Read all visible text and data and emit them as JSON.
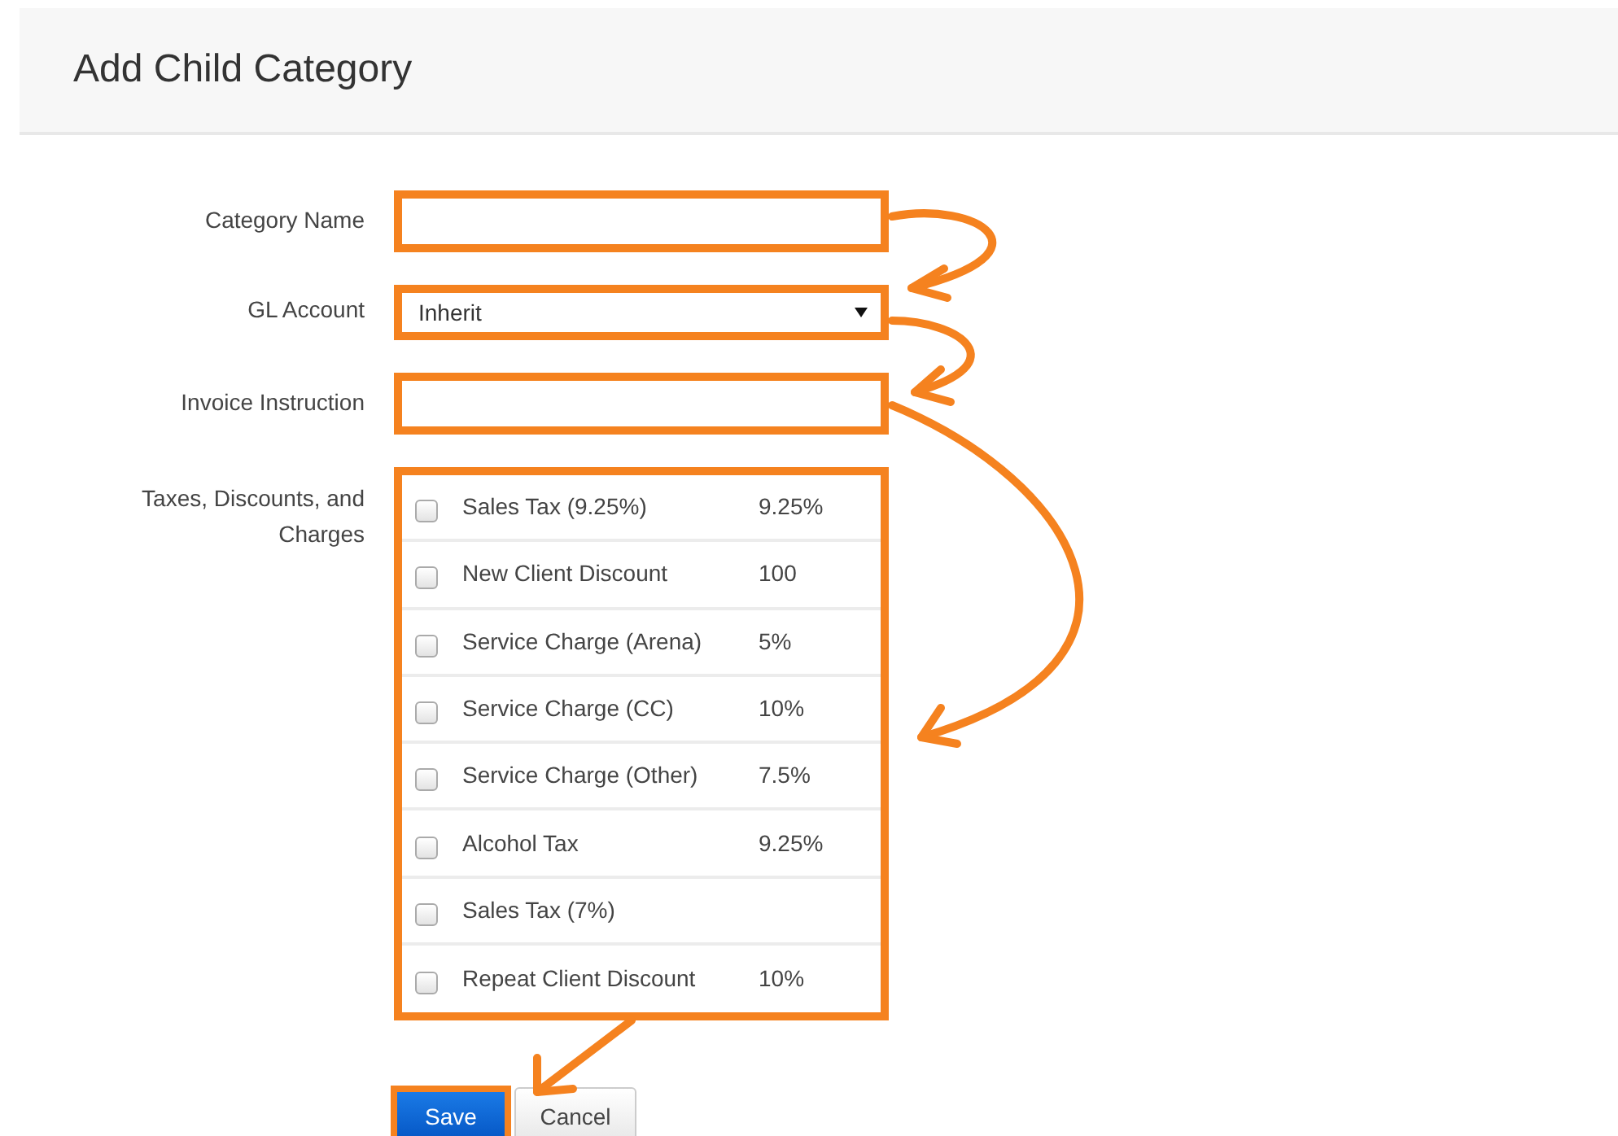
{
  "header": {
    "title": "Add Child Category"
  },
  "fields": [
    {
      "kind": "text",
      "label": "Category Name"
    },
    {
      "kind": "select",
      "label": "GL Account",
      "value": "Inherit"
    },
    {
      "kind": "text",
      "label": "Invoice Instruction"
    }
  ],
  "charges": {
    "label": "Taxes, Discounts, and Charges",
    "items": [
      {
        "name": "Sales Tax (9.25%)",
        "amount": "9.25%",
        "checked": false
      },
      {
        "name": "New Client Discount",
        "amount": "100",
        "checked": false
      },
      {
        "name": "Service Charge (Arena)",
        "amount": "5%",
        "checked": false
      },
      {
        "name": "Service Charge (CC)",
        "amount": "10%",
        "checked": false
      },
      {
        "name": "Service Charge (Other)",
        "amount": "7.5%",
        "checked": false
      },
      {
        "name": "Alcohol Tax",
        "amount": "9.25%",
        "checked": false
      },
      {
        "name": "Sales Tax (7%)",
        "checked": false
      },
      {
        "name": "Repeat Client Discount",
        "amount": "10%",
        "checked": false
      }
    ]
  },
  "buttons": [
    {
      "label": "Save",
      "kind": "primary"
    },
    {
      "label": "Cancel",
      "kind": "default"
    }
  ]
}
